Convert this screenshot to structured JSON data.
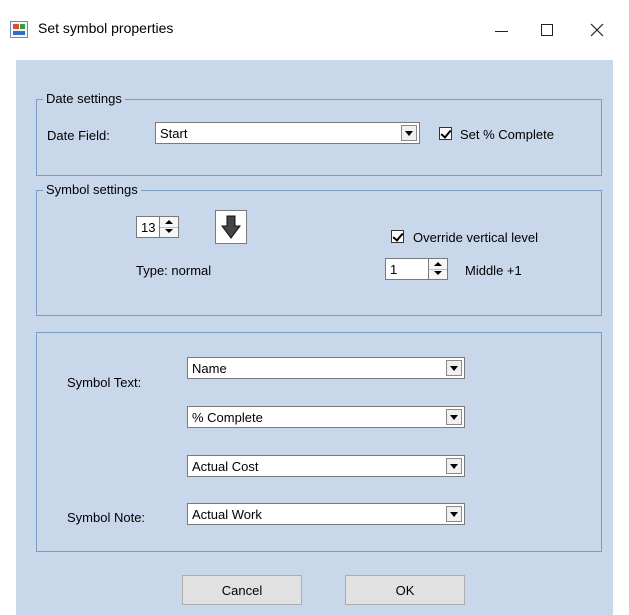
{
  "window": {
    "title": "Set symbol properties",
    "controls": {
      "minimize": "—",
      "maximize": "☐",
      "close": "✕"
    }
  },
  "date_settings": {
    "legend": "Date settings",
    "date_field_label": "Date Field:",
    "date_field_value": "Start",
    "set_complete_label": "Set % Complete",
    "set_complete_checked": true
  },
  "symbol_settings": {
    "legend": "Symbol settings",
    "size_value": "13",
    "symbol_icon": "down-arrow-icon",
    "type_label": "Type: normal",
    "override_label": "Override vertical level",
    "override_checked": true,
    "level_value": "1",
    "level_description": "Middle +1"
  },
  "text_settings": {
    "symbol_text_label": "Symbol Text:",
    "text_fields": [
      "Name",
      "% Complete",
      "Actual Cost"
    ],
    "symbol_note_label": "Symbol Note:",
    "note_field": "Actual Work"
  },
  "buttons": {
    "cancel": "Cancel",
    "ok": "OK"
  }
}
